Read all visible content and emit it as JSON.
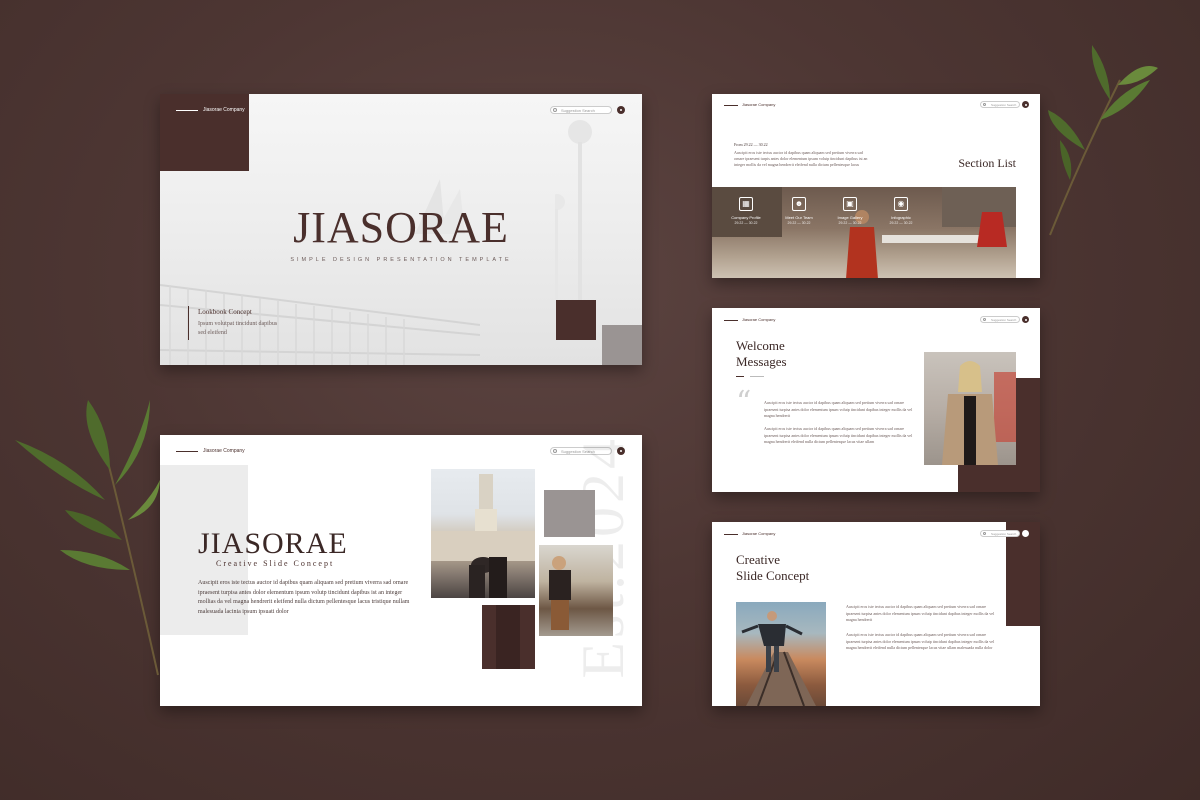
{
  "brand": {
    "company": "Jiasorae Company",
    "search_placeholder": "Suggestion Search"
  },
  "slide1": {
    "title": "JIASORAE",
    "subtitle": "SIMPLE DESIGN PRESENTATION TEMPLATE",
    "concept_heading": "Lookbook Concept",
    "concept_text": "Ipsum volutpat tincidunt dapibus sed eleifend"
  },
  "slide2": {
    "title": "JIASORAE",
    "subtitle": "Creative Slide Concept",
    "body": "Auscipit eros iste tectus auctor id dapibus quam aliquam sed pretium viverra sad ornare ipraesent turpisa antes dolor elementum ipsum volutp tincidunt dapibus ist an integer mollias da vel magna hendrerit eleifend nulla dictum pellentesque lacus tristique nullam malesuada lacinia ipsum ipsuati dolor",
    "watermark": "Est.2024"
  },
  "slide3": {
    "title": "Section List",
    "date_label": "From 29.22 — 30.22",
    "text": "Auscipit eros iste tectus auctor id dapibus quam aliquam sed pretium viverra sad ornare ipraesent turpis antes dolor elementum ipsum volutp tincidunt dapibus ist an integer mollis da vel magna hendrerit eleifend nulla dictum pellentesque lacus",
    "items": [
      {
        "icon": "▦",
        "label": "Company Profile",
        "num": "29.22 — 30.22"
      },
      {
        "icon": "☻",
        "label": "Meet Our Team",
        "num": "29.22 — 30.22"
      },
      {
        "icon": "▣",
        "label": "Image Gallery",
        "num": "29.22 — 30.22"
      },
      {
        "icon": "◉",
        "label": "Infographic",
        "num": "29.22 — 30.22"
      }
    ]
  },
  "slide4": {
    "title_line1": "Welcome",
    "title_line2": "Messages",
    "quote_mark": "“",
    "para1": "Auscipit eros iste tectus auctor id dapibus quam aliquam sed pretium viverra sad ornare ipraesent turpisa antes dolor elementum ipsum volutp tincidunt dapibus integer mollis da vel magna hendrerit",
    "para2": "Auscipit eros iste tectus auctor id dapibus quam aliquam sed pretium viverra sad ornare ipraesent turpisa antes dolor elementum ipsum volutp tincidunt dapibus integer mollis da vel magna hendrerit eleifend nulla dictum pellentesque lacus vitae ullam"
  },
  "slide5": {
    "title_line1": "Creative",
    "title_line2": "Slide Concept",
    "para1": "Auscipit eros iste tectus auctor id dapibus quam aliquam sed pretium viverra sad ornare ipraesent turpisa antes dolor elementum ipsum volutp tincidunt dapibus integer mollis da vel magna hendrerit",
    "para2": "Auscipit eros iste tectus auctor id dapibus quam aliquam sed pretium viverra sad ornare ipraesent turpisa antes dolor elementum ipsum volutp tincidunt dapibus integer mollis da vel magna hendrerit eleifend nulla dictum pellentesque lacus vitae ullam malesuada nulla dolor"
  },
  "colors": {
    "background": "#4d3633",
    "brown": "#4a2f2c",
    "grey": "#9a9493",
    "leaf": "#4f6b2c"
  }
}
